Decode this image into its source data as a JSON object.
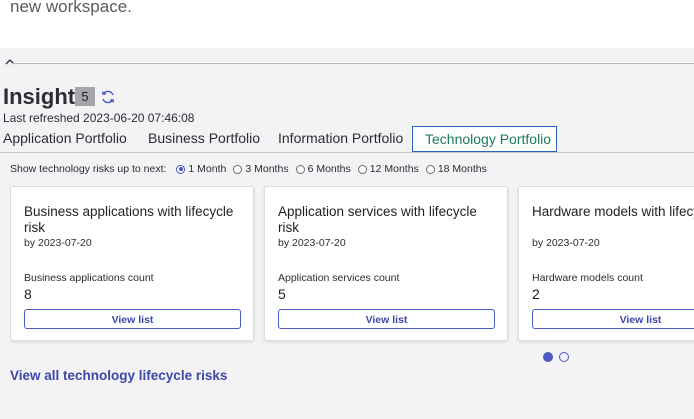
{
  "intro": {
    "text": "new workspace."
  },
  "insights": {
    "title": "Insights",
    "count": "5",
    "last_refreshed": "Last refreshed 2023-06-20 07:46:08"
  },
  "tabs": [
    {
      "label": "Application Portfolio",
      "active": false
    },
    {
      "label": "Business Portfolio",
      "active": false
    },
    {
      "label": "Information Portfolio",
      "active": false
    },
    {
      "label": "Technology Portfolio",
      "active": true
    }
  ],
  "risk_range": {
    "label": "Show technology risks up to next:",
    "options": [
      "1 Month",
      "3 Months",
      "6 Months",
      "12 Months",
      "18 Months"
    ],
    "selected": "1 Month"
  },
  "cards": [
    {
      "title": "Business applications with lifecycle risk",
      "date": "by 2023-07-20",
      "count_label": "Business applications count",
      "count": "8",
      "button": "View list"
    },
    {
      "title": "Application services with lifecycle risk",
      "date": "by 2023-07-20",
      "count_label": "Application services count",
      "count": "5",
      "button": "View list"
    },
    {
      "title": "Hardware models with lifecycle risk",
      "date": "by 2023-07-20",
      "count_label": "Hardware models count",
      "count": "2",
      "button": "View list"
    }
  ],
  "carousel": {
    "pages": 2,
    "active_page": 1
  },
  "footer": {
    "view_all": "View all technology lifecycle risks"
  },
  "colors": {
    "accent": "#4b59c2",
    "active_tab_text": "#1b7a5e",
    "active_tab_border": "#2a5fc4"
  },
  "icons": {
    "collapse": "chevron-up-icon",
    "refresh": "refresh-icon"
  }
}
